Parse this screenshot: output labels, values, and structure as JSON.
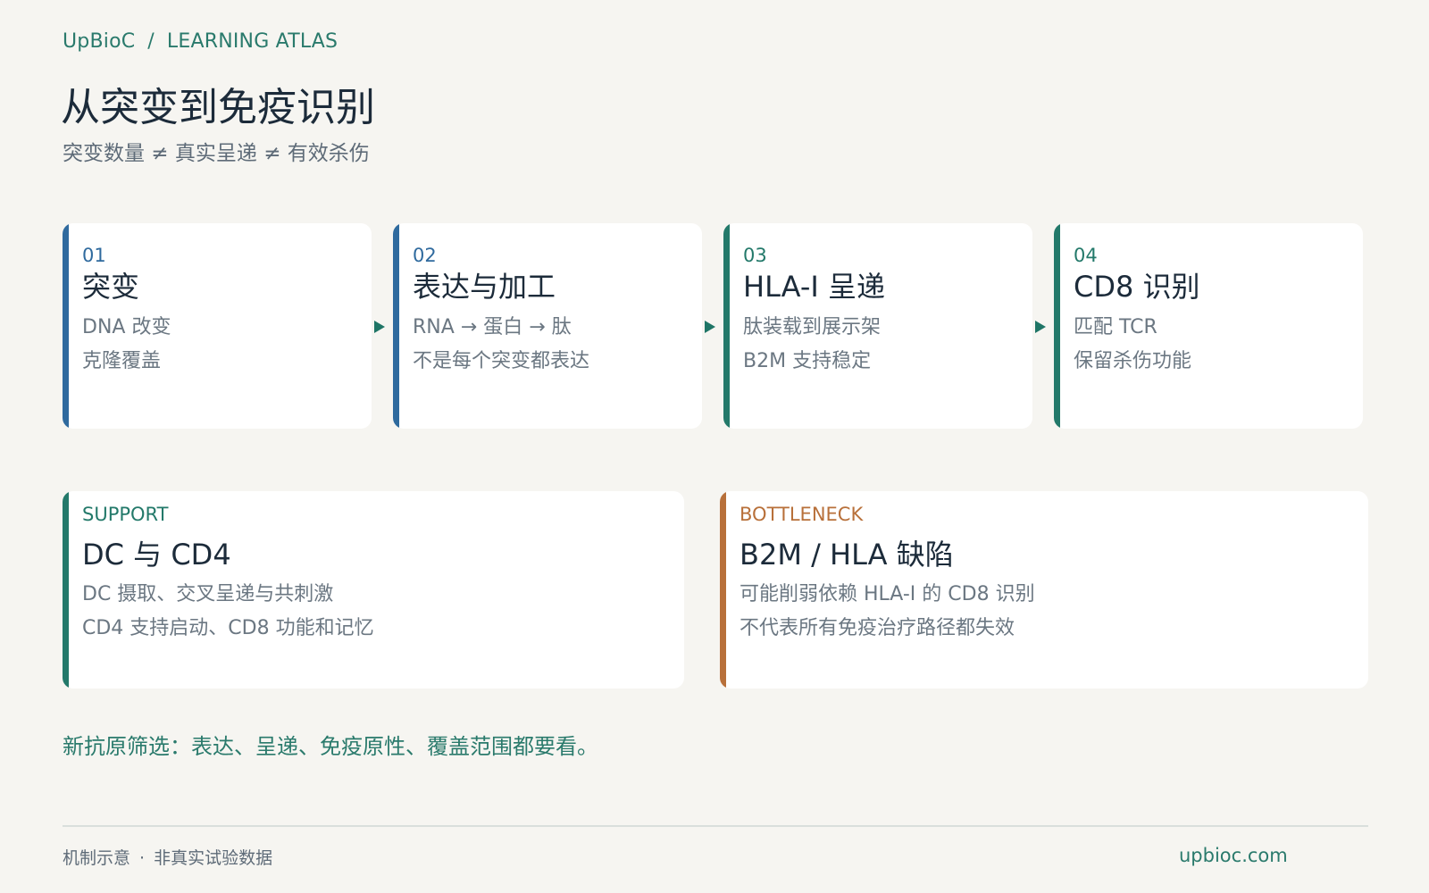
{
  "header": {
    "brand": "UpBioC",
    "separator": "/",
    "section": "LEARNING ATLAS",
    "title": "从突变到免疫识别",
    "subtitle": "突变数量 ≠ 真实呈递 ≠ 有效杀伤"
  },
  "steps": [
    {
      "num": "01",
      "name": "突变",
      "line1": "DNA 改变",
      "line2": "克隆覆盖",
      "color": "#2f6a9e"
    },
    {
      "num": "02",
      "name": "表达与加工",
      "line1": "RNA → 蛋白 → 肽",
      "line2": "不是每个突变都表达",
      "color": "#2f6a9e"
    },
    {
      "num": "03",
      "name": "HLA-I 呈递",
      "line1": "肽装载到展示架",
      "line2": "B2M 支持稳定",
      "color": "#23796a"
    },
    {
      "num": "04",
      "name": "CD8 识别",
      "line1": "匹配 TCR",
      "line2": "保留杀伤功能",
      "color": "#23796a"
    }
  ],
  "panels": {
    "support": {
      "tag": "SUPPORT",
      "name": "DC 与 CD4",
      "line1": "DC 摄取、交叉呈递与共刺激",
      "line2": "CD4 支持启动、CD8 功能和记忆",
      "color": "#23796a"
    },
    "bottleneck": {
      "tag": "BOTTLENECK",
      "name": "B2M / HLA 缺陷",
      "line1": "可能削弱依赖 HLA-I 的 CD8 识别",
      "line2": "不代表所有免疫治疗路径都失效",
      "color": "#b8703a"
    }
  },
  "note": "新抗原筛选：表达、呈递、免疫原性、覆盖范围都要看。",
  "footer": {
    "left_a": "机制示意",
    "dot": "·",
    "left_b": "非真实试验数据",
    "right": "upbioc.com"
  }
}
